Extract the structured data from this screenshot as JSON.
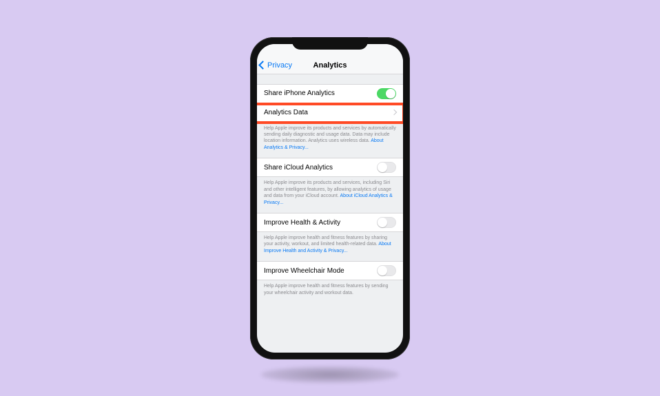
{
  "nav": {
    "back_label": "Privacy",
    "title": "Analytics"
  },
  "sections": {
    "share_iphone": {
      "label": "Share iPhone Analytics",
      "toggle_on": true
    },
    "analytics_data": {
      "label": "Analytics Data"
    },
    "iphone_footer": {
      "text": "Help Apple improve its products and services by automatically sending daily diagnostic and usage data. Data may include location information. Analytics uses wireless data. ",
      "link": "About Analytics & Privacy..."
    },
    "share_icloud": {
      "label": "Share iCloud Analytics",
      "toggle_on": false
    },
    "icloud_footer": {
      "text": "Help Apple improve its products and services, including Siri and other intelligent features, by allowing analytics of usage and data from your iCloud account. ",
      "link": "About iCloud Analytics & Privacy..."
    },
    "health": {
      "label": "Improve Health & Activity",
      "toggle_on": false
    },
    "health_footer": {
      "text": "Help Apple improve health and fitness features by sharing your activity, workout, and limited health-related data. ",
      "link": "About Improve Health and Activity & Privacy..."
    },
    "wheelchair": {
      "label": "Improve Wheelchair Mode",
      "toggle_on": false
    },
    "wheelchair_footer": {
      "text": "Help Apple improve health and fitness features by sending your wheelchair activity and workout data.",
      "link": ""
    }
  }
}
